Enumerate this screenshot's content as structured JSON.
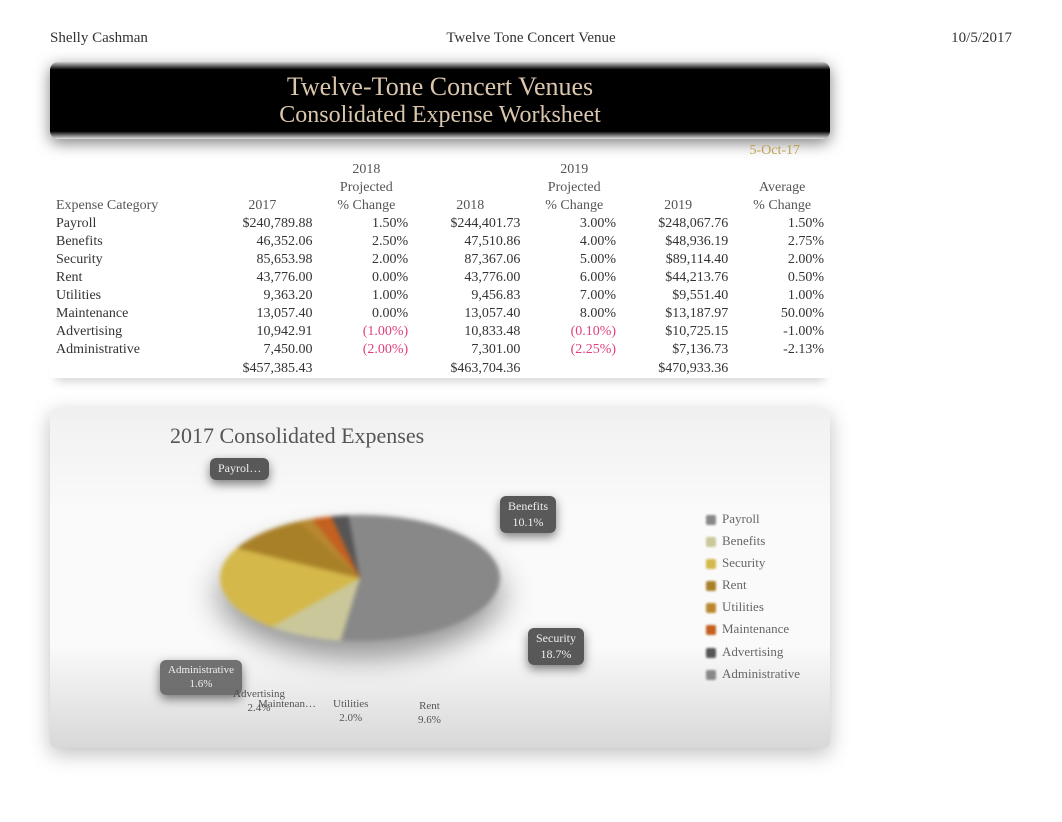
{
  "header": {
    "left": "Shelly Cashman",
    "center": "Twelve Tone Concert Venue",
    "right": "10/5/2017"
  },
  "title": {
    "line1": "Twelve-Tone Concert Venues",
    "line2": "Consolidated Expense Worksheet"
  },
  "sheet_date": "5-Oct-17",
  "columns": {
    "cat": "Expense Category",
    "c2017": "2017",
    "p2018_a": "2018",
    "p2018_b": "Projected",
    "p2018_c": "% Change",
    "c2018": "2018",
    "p2019_a": "2019",
    "p2019_b": "Projected",
    "p2019_c": "% Change",
    "c2019": "2019",
    "avg_a": "Average",
    "avg_b": "% Change"
  },
  "rows": [
    {
      "cat": "Payroll",
      "c2017": "$240,789.88",
      "p2018": "1.50%",
      "c2018": "$244,401.73",
      "p2019": "3.00%",
      "c2019": "$248,067.76",
      "avg": "1.50%",
      "neg18": false,
      "neg19": false
    },
    {
      "cat": "Benefits",
      "c2017": "46,352.06",
      "p2018": "2.50%",
      "c2018": "47,510.86",
      "p2019": "4.00%",
      "c2019": "$48,936.19",
      "avg": "2.75%",
      "neg18": false,
      "neg19": false
    },
    {
      "cat": "Security",
      "c2017": "85,653.98",
      "p2018": "2.00%",
      "c2018": "87,367.06",
      "p2019": "5.00%",
      "c2019": "$89,114.40",
      "avg": "2.00%",
      "neg18": false,
      "neg19": false
    },
    {
      "cat": "Rent",
      "c2017": "43,776.00",
      "p2018": "0.00%",
      "c2018": "43,776.00",
      "p2019": "6.00%",
      "c2019": "$44,213.76",
      "avg": "0.50%",
      "neg18": false,
      "neg19": false
    },
    {
      "cat": "Utilities",
      "c2017": "9,363.20",
      "p2018": "1.00%",
      "c2018": "9,456.83",
      "p2019": "7.00%",
      "c2019": "$9,551.40",
      "avg": "1.00%",
      "neg18": false,
      "neg19": false
    },
    {
      "cat": "Maintenance",
      "c2017": "13,057.40",
      "p2018": "0.00%",
      "c2018": "13,057.40",
      "p2019": "8.00%",
      "c2019": "$13,187.97",
      "avg": "50.00%",
      "neg18": false,
      "neg19": false
    },
    {
      "cat": "Advertising",
      "c2017": "10,942.91",
      "p2018": "(1.00%)",
      "c2018": "10,833.48",
      "p2019": "(0.10%)",
      "c2019": "$10,725.15",
      "avg": "-1.00%",
      "neg18": true,
      "neg19": true
    },
    {
      "cat": "Administrative",
      "c2017": "7,450.00",
      "p2018": "(2.00%)",
      "c2018": "7,301.00",
      "p2019": "(2.25%)",
      "c2019": "$7,136.73",
      "avg": "-2.13%",
      "neg18": true,
      "neg19": true
    }
  ],
  "totals": {
    "c2017": "$457,385.43",
    "c2018": "$463,704.36",
    "c2019": "$470,933.36"
  },
  "chart_data": {
    "type": "pie",
    "title": "2017 Consolidated Expenses",
    "categories": [
      "Payroll",
      "Benefits",
      "Security",
      "Rent",
      "Utilities",
      "Maintenance",
      "Advertising",
      "Administrative"
    ],
    "values": [
      240789.88,
      46352.06,
      85653.98,
      43776.0,
      9363.2,
      13057.4,
      10942.91,
      7450.0
    ],
    "percent_labels": {
      "Payroll": "Payrol…",
      "Benefits": "10.1%",
      "Security": "18.7%",
      "Rent": "9.6%",
      "Utilities": "2.0%",
      "Maintenance": "Maintenan…",
      "Advertising": "2.4%",
      "Administrative": "1.6%"
    },
    "legend": [
      "Payroll",
      "Benefits",
      "Security",
      "Rent",
      "Utilities",
      "Maintenance",
      "Advertising",
      "Administrative"
    ]
  },
  "slice_labels": {
    "payroll_name": "Payrol…",
    "benefits_name": "Benefits",
    "benefits_pct": "10.1%",
    "security_name": "Security",
    "security_pct": "18.7%",
    "rent_name": "Rent",
    "rent_pct": "9.6%",
    "utilities_name": "Utilities",
    "utilities_pct": "2.0%",
    "maintenance_name": "Maintenan…",
    "advertising_name": "Advertising",
    "advertising_pct": "2.4%",
    "administrative_name": "Administrative",
    "administrative_pct": "1.6%"
  }
}
